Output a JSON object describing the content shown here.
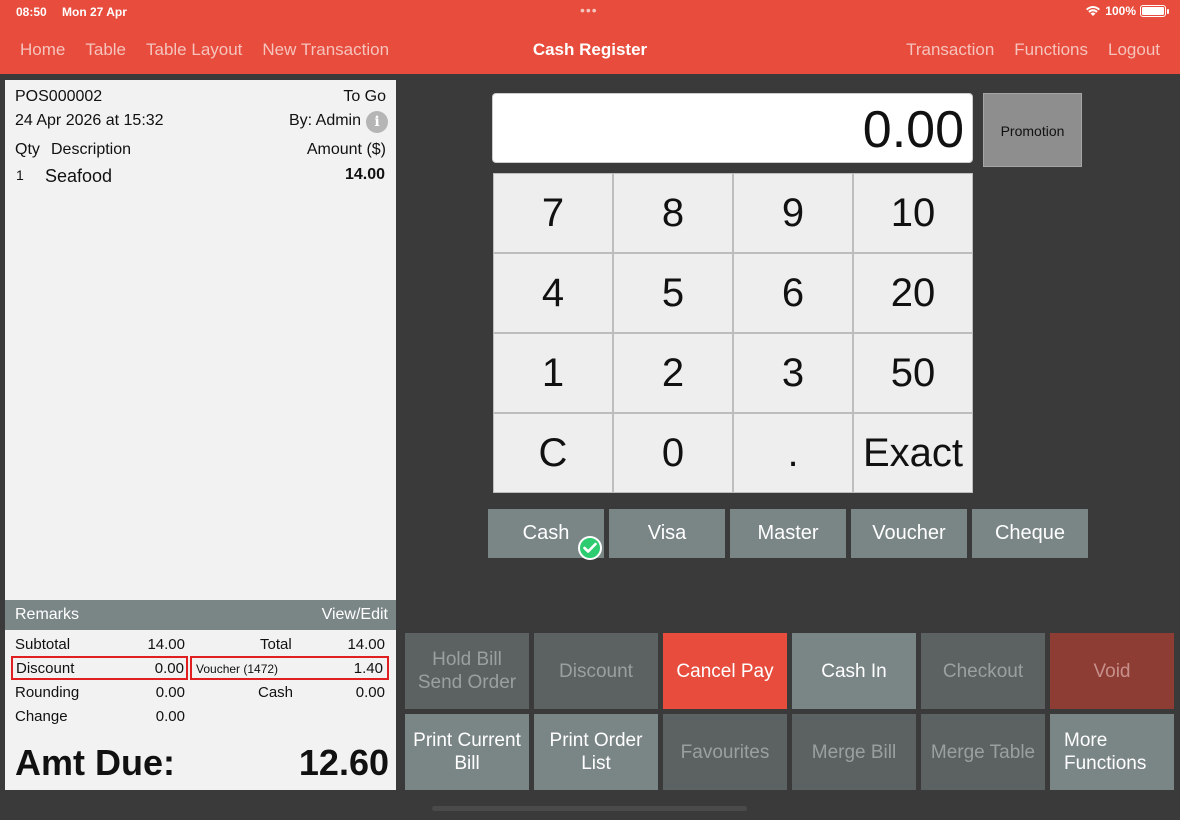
{
  "status": {
    "time": "08:50",
    "date": "Mon 27 Apr",
    "battery": "100%"
  },
  "nav": {
    "left": [
      "Home",
      "Table",
      "Table Layout",
      "New Transaction"
    ],
    "title": "Cash Register",
    "right": [
      "Transaction",
      "Functions",
      "Logout"
    ]
  },
  "receipt": {
    "order_no": "POS000002",
    "order_type": "To Go",
    "datetime": "24 Apr 2026 at 15:32",
    "by": "By: Admin",
    "col_qty": "Qty",
    "col_desc": "Description",
    "col_amount": "Amount ($)",
    "items": [
      {
        "qty": "1",
        "desc": "Seafood",
        "amount": "14.00"
      }
    ],
    "remarks_label": "Remarks",
    "remarks_edit": "View/Edit",
    "subtotal_label": "Subtotal",
    "subtotal": "14.00",
    "total_label": "Total",
    "total": "14.00",
    "discount_label": "Discount",
    "discount": "0.00",
    "voucher_label": "Voucher (1472)",
    "voucher": "1.40",
    "rounding_label": "Rounding",
    "rounding": "0.00",
    "cash_label": "Cash",
    "cash": "0.00",
    "change_label": "Change",
    "change": "0.00",
    "amt_due_label": "Amt Due:",
    "amt_due": "12.60"
  },
  "display": {
    "value": "0.00",
    "promotion": "Promotion"
  },
  "keypad": [
    "7",
    "8",
    "9",
    "10",
    "4",
    "5",
    "6",
    "20",
    "1",
    "2",
    "3",
    "50",
    "C",
    "0",
    ".",
    "Exact"
  ],
  "payment_methods": [
    "Cash",
    "Visa",
    "Master",
    "Voucher",
    "Cheque"
  ],
  "selected_payment": "Cash",
  "actions": {
    "hold_bill": "Hold Bill",
    "send_order": "Send Order",
    "discount": "Discount",
    "cancel_pay": "Cancel Pay",
    "cash_in": "Cash In",
    "checkout": "Checkout",
    "void": "Void",
    "print_current_bill": "Print Current Bill",
    "print_order_list": "Print Order List",
    "favourites": "Favourites",
    "merge_bill": "Merge Bill",
    "merge_table": "Merge Table",
    "more_functions": "More Functions"
  },
  "colors": {
    "brand": "#e74c3c",
    "button": "#7a8585",
    "check": "#2ecc71"
  }
}
